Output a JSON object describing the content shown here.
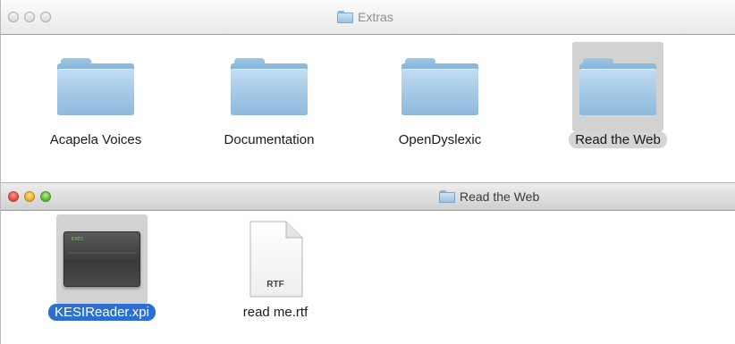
{
  "extras_window": {
    "title": "Extras",
    "items": [
      {
        "name": "Acapela Voices",
        "icon": "folder-icon",
        "selected": false
      },
      {
        "name": "Documentation",
        "icon": "folder-icon",
        "selected": false
      },
      {
        "name": "OpenDyslexic",
        "icon": "folder-icon",
        "selected": false
      },
      {
        "name": "Read the Web",
        "icon": "folder-icon",
        "selected": true
      }
    ]
  },
  "read_the_web_window": {
    "title": "Read the Web",
    "items": [
      {
        "name": "KESIReader.xpi",
        "icon": "xpi-file-icon",
        "selected": true,
        "icon_text": "EXEC"
      },
      {
        "name": "read me.rtf",
        "icon": "rtf-document-icon",
        "selected": false,
        "file_type": "RTF"
      }
    ]
  },
  "colors": {
    "selection_blue": "#2b6fd1",
    "selection_gray": "#d4d4d4",
    "folder_blue": "#a8cbe8"
  }
}
